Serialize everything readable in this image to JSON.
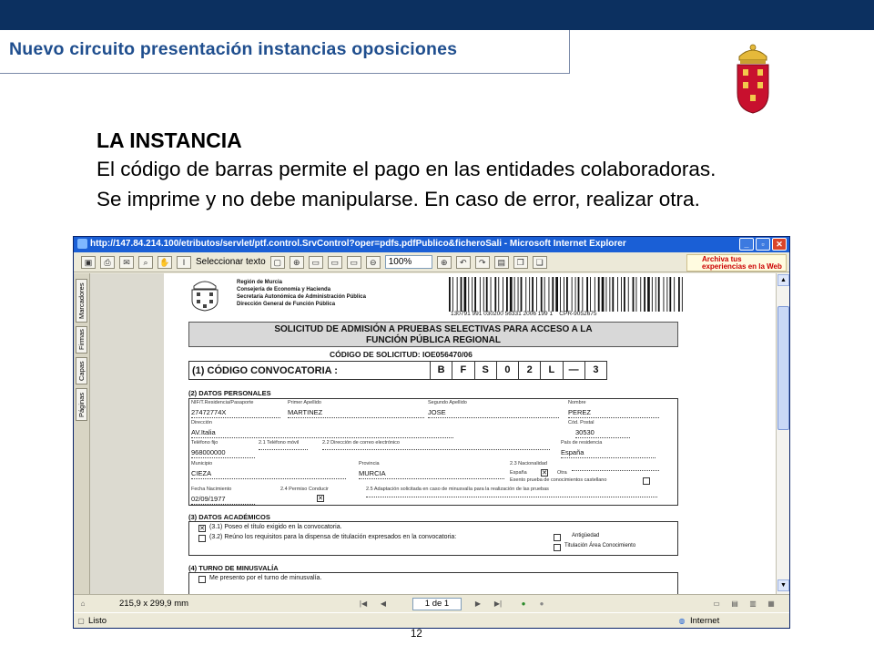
{
  "slide": {
    "title": "Nuevo circuito presentación instancias oposiciones",
    "heading": "LA INSTANCIA",
    "line1": "El código de barras permite el pago en las entidades colaboradoras.",
    "line2": "Se imprime y no debe manipularse. En caso de error, realizar otra.",
    "page_number": "12"
  },
  "browser": {
    "title": "http://147.84.214.100/etributos/servlet/ptf.control.SrvControl?oper=pdfs.pdfPublico&ficheroSali - Microsoft Internet Explorer",
    "toolbar": {
      "select_text": "Seleccionar texto",
      "zoom": "100%",
      "help_box": "Archiva tus experiencias en la Web"
    },
    "side_tabs": [
      "Marcadores",
      "Firmas",
      "Capas",
      "Páginas"
    ],
    "page_size": "215,9 x 299,9 mm",
    "page_indicator": "1 de 1",
    "status_left": "Listo",
    "status_right": "Internet"
  },
  "pdf": {
    "org_lines": [
      "Región de Murcia",
      "Consejería de Economía y Hacienda",
      "Secretaría Autonómica de Administración Pública",
      "Dirección General de Función Pública"
    ],
    "barcode_text": "130791 991 030200 56331 2006 199 1",
    "barcode_code": "CPR-9052675",
    "form_title_1": "SOLICITUD DE ADMISIÓN A PRUEBAS SELECTIVAS PARA ACCESO A LA",
    "form_title_2": "FUNCIÓN PÚBLICA REGIONAL",
    "codigo_solicitud": "CÓDIGO DE SOLICITUD: IOE056470/06",
    "convocatoria_label": "(1) CÓDIGO CONVOCATORIA :",
    "convocatoria_cells": [
      "B",
      "F",
      "S",
      "0",
      "2",
      "L",
      "—",
      "3"
    ],
    "datos_personales": {
      "section": "(2) DATOS PERSONALES",
      "nif_label": "NIF/T.Residencia/Pasaporte",
      "nif": "27472774X",
      "apellido1_label": "Primer Apellido",
      "apellido1": "MARTINEZ",
      "apellido2_label": "Segundo Apellido",
      "apellido2": "JOSE",
      "nombre_label": "Nombre",
      "nombre": "PEREZ",
      "direccion_label": "Dirección",
      "direccion": "AV.Italia",
      "cp_label": "Cód. Postal",
      "cp": "30530",
      "telefono_label": "Teléfono fijo",
      "telefono": "968000000",
      "movil_label": "2.1 Teléfono móvil",
      "email_label": "2.2 Dirección de correo electrónico",
      "pais_label": "País de residencia",
      "pais": "España",
      "municipio_label": "Municipio",
      "municipio": "CIEZA",
      "provincia_label": "Provincia",
      "provincia": "MURCIA",
      "nacionalidad_label": "2.3 Nacionalidad",
      "espana_label": "España",
      "otra_label": "Otra",
      "exento_label": "Exento prueba de conocimientos castellano",
      "nacimiento_label": "Fecha Nacimiento",
      "nacimiento": "02/09/1977",
      "permiso_label": "2.4 Permiso Conducir",
      "adaptacion_label": "2.5 Adaptación solicitada en caso de minusvalía para la realización de las pruebas"
    },
    "datos_academicos": {
      "section": "(3) DATOS ACADÉMICOS",
      "opt1": "(3.1) Poseo el título exigido en la convocatoria.",
      "opt2": "(3.2) Reúno los requisitos para la dispensa de titulación expresados en la convocatoria:",
      "antiguedad": "Antigüedad",
      "titulacion": "Titulación Área Conocimiento"
    },
    "minusvalia": {
      "section": "(4) TURNO DE MINUSVALÍA",
      "opt": "Me presento por el turno de minusvalía."
    }
  },
  "colors": {
    "top_bar": "#0c3060",
    "title_text": "#1f4e8e",
    "xp_title": "#1a5fd6"
  }
}
